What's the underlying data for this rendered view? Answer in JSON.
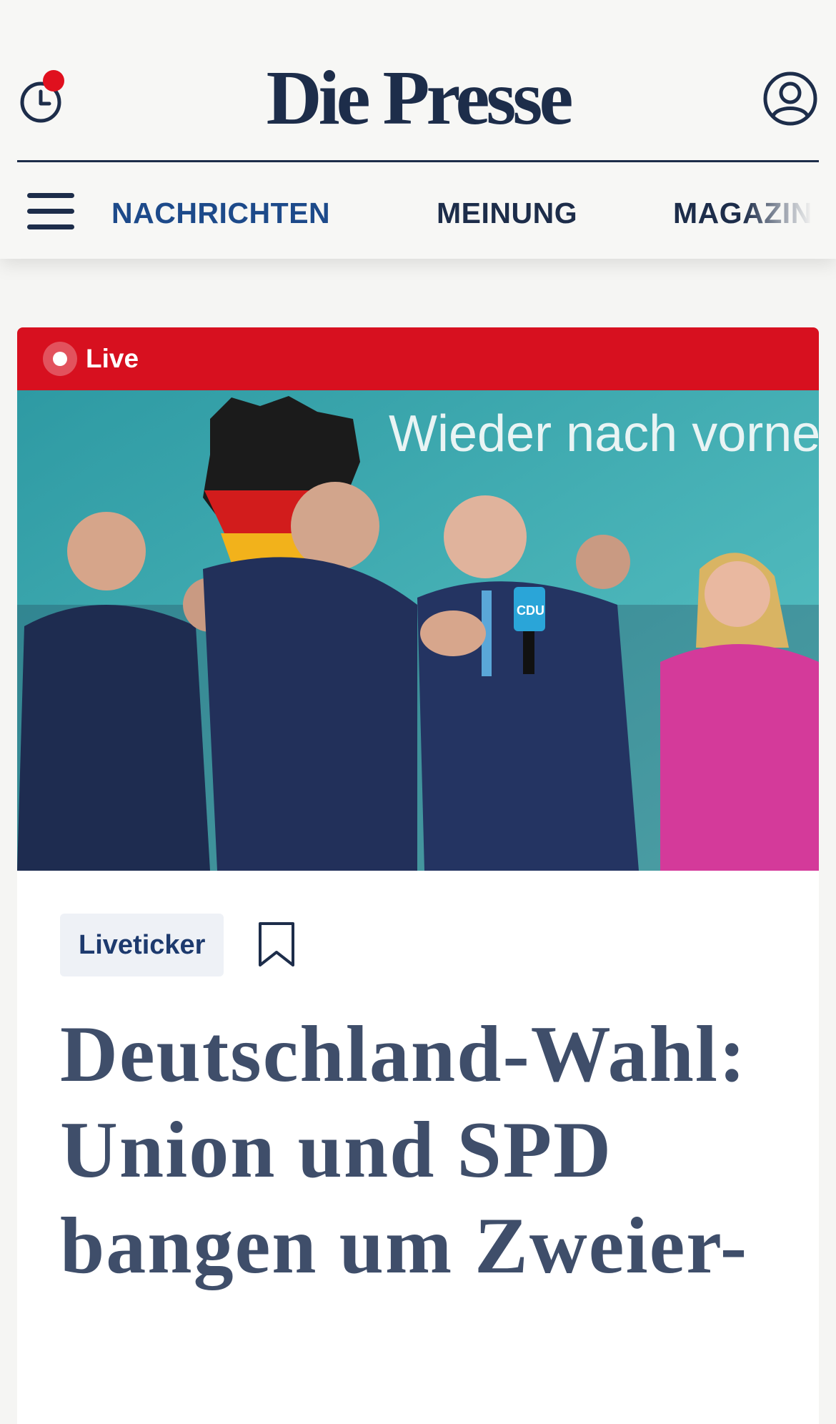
{
  "header": {
    "brand": "Die Presse",
    "history_icon": "clock-history-icon",
    "history_has_unread": true,
    "account_icon": "user-account-icon",
    "menu_icon": "hamburger-menu-icon"
  },
  "nav": {
    "items": [
      {
        "label": "NACHRICHTEN",
        "active": true
      },
      {
        "label": "MEINUNG",
        "active": false
      },
      {
        "label": "MAGAZIN",
        "active": false
      }
    ]
  },
  "article": {
    "live_label": "Live",
    "tag": "Liveticker",
    "bookmark_icon": "bookmark-icon",
    "headline": "Deutschland-Wahl: Union und SPD bangen um Zweier-",
    "image_text": {
      "slogan": "Wieder nach vorne",
      "mic_logo": "CDU"
    }
  },
  "colors": {
    "brand_navy": "#1d2d4a",
    "nav_active": "#1d4a8a",
    "live_red": "#d7101f",
    "notification_red": "#e0101e",
    "tag_bg": "#eef1f6",
    "headline": "#3f4e6a"
  }
}
